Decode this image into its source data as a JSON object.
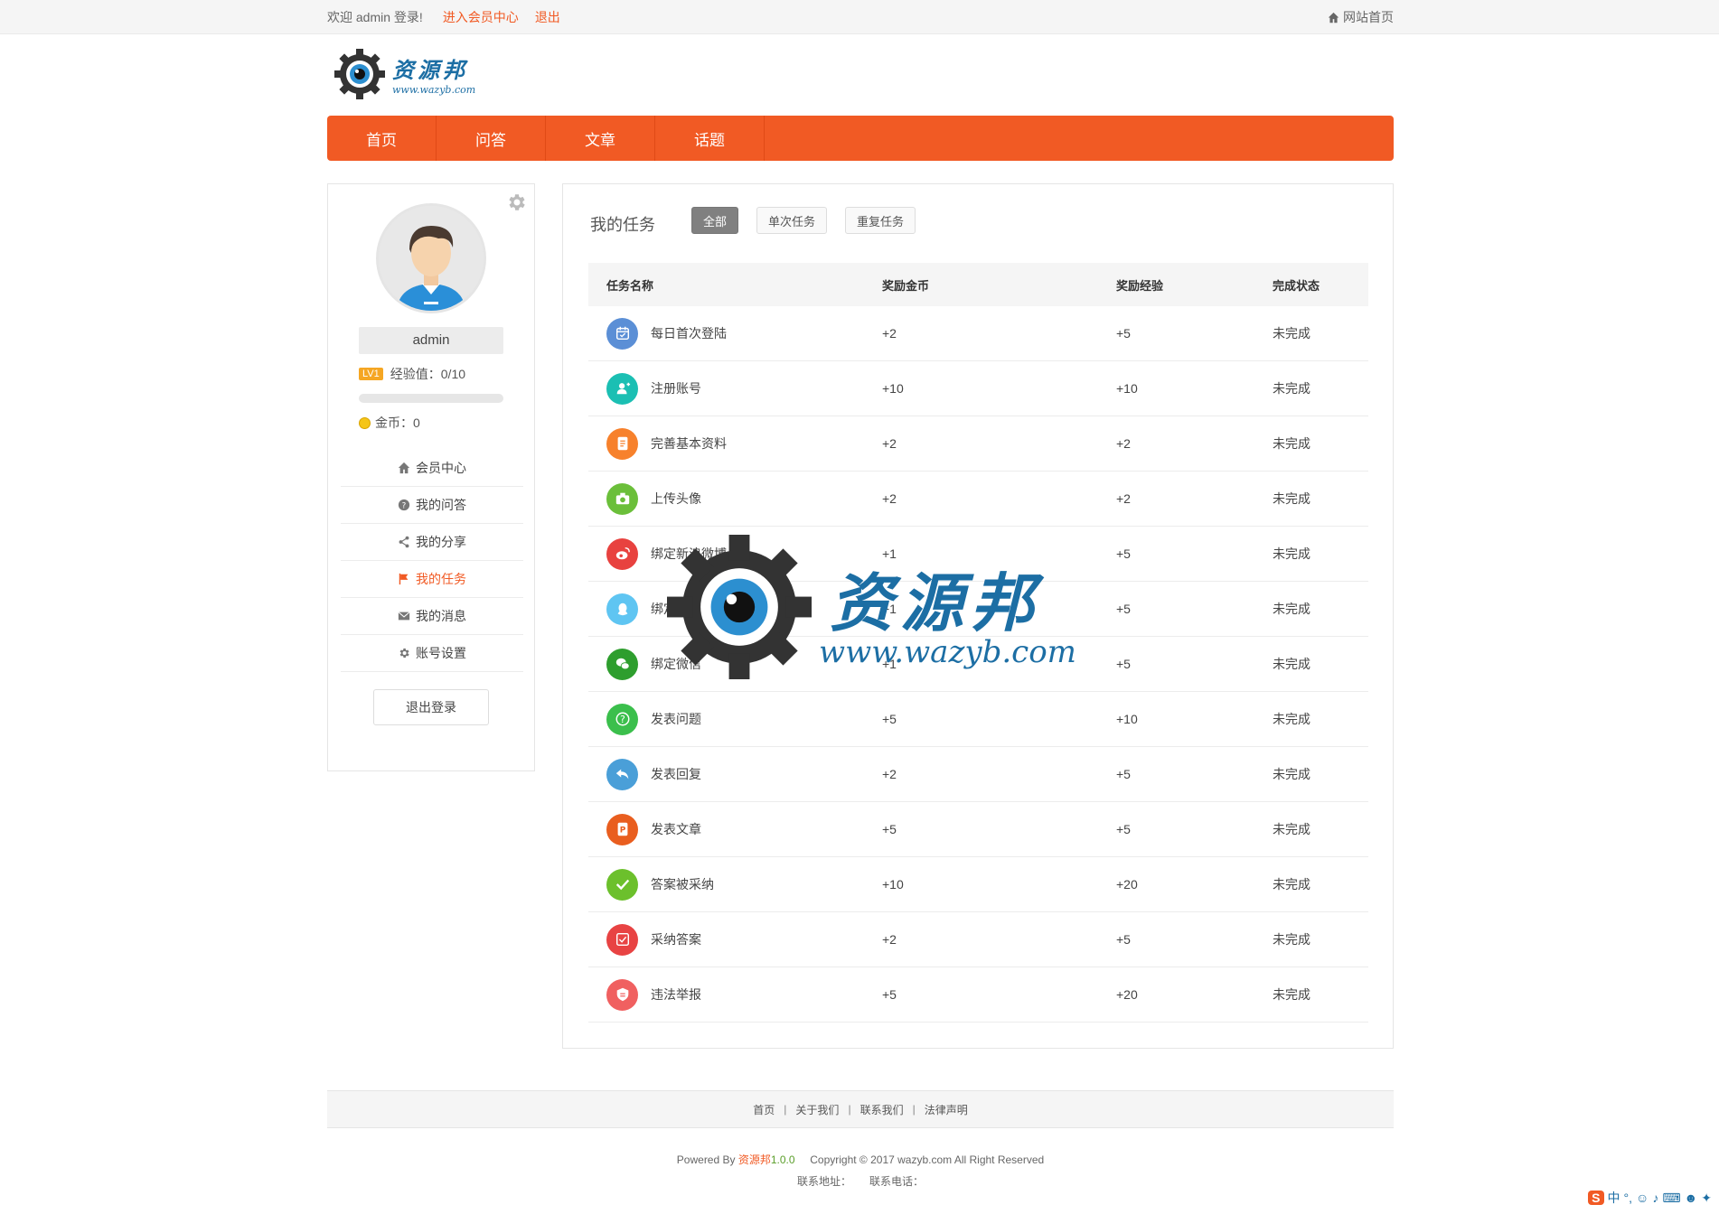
{
  "topbar": {
    "welcome": "欢迎  admin  登录!",
    "member_center": "进入会员中心",
    "logout": "退出",
    "site_home": "网站首页"
  },
  "logo": {
    "name": "资源邦",
    "url": "www.wazyb.com"
  },
  "nav": [
    {
      "label": "首页"
    },
    {
      "label": "问答"
    },
    {
      "label": "文章"
    },
    {
      "label": "话题"
    }
  ],
  "profile": {
    "username": "admin",
    "level": "LV1",
    "exp_text": "经验值：0/10",
    "exp_progress": 0,
    "coins_text": "金币：0"
  },
  "side_menu": [
    {
      "label": "会员中心",
      "icon": "home-icon"
    },
    {
      "label": "我的问答",
      "icon": "question-icon"
    },
    {
      "label": "我的分享",
      "icon": "share-icon"
    },
    {
      "label": "我的任务",
      "icon": "flag-icon",
      "active": true
    },
    {
      "label": "我的消息",
      "icon": "mail-icon"
    },
    {
      "label": "账号设置",
      "icon": "gear-icon"
    }
  ],
  "logout_button": "退出登录",
  "tasks": {
    "title": "我的任务",
    "filters": [
      {
        "label": "全部",
        "active": true
      },
      {
        "label": "单次任务"
      },
      {
        "label": "重复任务"
      }
    ],
    "headers": [
      "任务名称",
      "奖励金币",
      "奖励经验",
      "完成状态"
    ],
    "rows": [
      {
        "name": "每日首次登陆",
        "coins": "+2",
        "exp": "+5",
        "status": "未完成",
        "icon": "calendar-icon",
        "color": "#5b8fd6"
      },
      {
        "name": "注册账号",
        "coins": "+10",
        "exp": "+10",
        "status": "未完成",
        "icon": "user-add-icon",
        "color": "#1bbfb3"
      },
      {
        "name": "完善基本资料",
        "coins": "+2",
        "exp": "+2",
        "status": "未完成",
        "icon": "document-icon",
        "color": "#f7812c"
      },
      {
        "name": "上传头像",
        "coins": "+2",
        "exp": "+2",
        "status": "未完成",
        "icon": "camera-icon",
        "color": "#6bbf3a"
      },
      {
        "name": "绑定新浪微博",
        "coins": "+1",
        "exp": "+5",
        "status": "未完成",
        "icon": "weibo-icon",
        "color": "#e8423f"
      },
      {
        "name": "绑定QQ账号",
        "coins": "+1",
        "exp": "+5",
        "status": "未完成",
        "icon": "qq-icon",
        "color": "#5fc5f2"
      },
      {
        "name": "绑定微信",
        "coins": "+1",
        "exp": "+5",
        "status": "未完成",
        "icon": "wechat-icon",
        "color": "#2e9e2e"
      },
      {
        "name": "发表问题",
        "coins": "+5",
        "exp": "+10",
        "status": "未完成",
        "icon": "question-icon",
        "color": "#3bbf4c"
      },
      {
        "name": "发表回复",
        "coins": "+2",
        "exp": "+5",
        "status": "未完成",
        "icon": "reply-icon",
        "color": "#4a9fd8"
      },
      {
        "name": "发表文章",
        "coins": "+5",
        "exp": "+5",
        "status": "未完成",
        "icon": "article-icon",
        "color": "#e95e1f"
      },
      {
        "name": "答案被采纳",
        "coins": "+10",
        "exp": "+20",
        "status": "未完成",
        "icon": "check-icon",
        "color": "#6cc02c"
      },
      {
        "name": "采纳答案",
        "coins": "+2",
        "exp": "+5",
        "status": "未完成",
        "icon": "accept-icon",
        "color": "#e84343"
      },
      {
        "name": "违法举报",
        "coins": "+5",
        "exp": "+20",
        "status": "未完成",
        "icon": "shield-icon",
        "color": "#f06060"
      }
    ]
  },
  "footer": {
    "links": [
      "首页",
      "关于我们",
      "联系我们",
      "法律声明"
    ],
    "powered_prefix": "Powered By ",
    "powered_name": "资源邦",
    "powered_version": "1.0.0",
    "copyright": "Copyright © 2017 wazyb.com All Right Reserved",
    "address_label": "联系地址：",
    "phone_label": "联系电话："
  },
  "watermark": {
    "name": "资源邦",
    "url": "www.wazyb.com"
  },
  "ime": {
    "mode": "中"
  }
}
